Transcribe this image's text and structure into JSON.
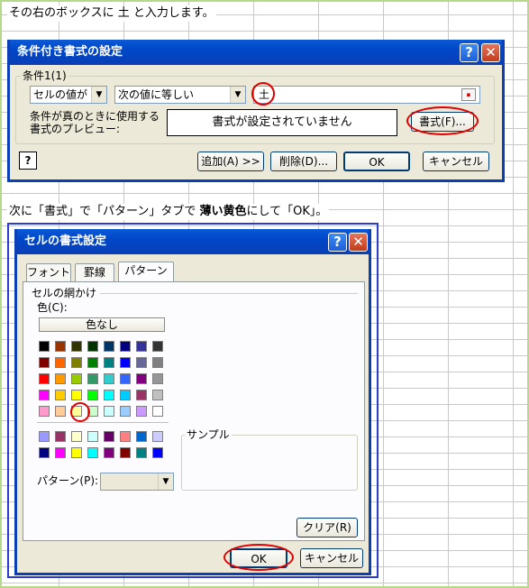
{
  "instructions": {
    "line1": "その右のボックスに 土 と入力します。",
    "line2_a": "次に「書式」で「パターン」タブで ",
    "line2_b": "薄い黄色",
    "line2_c": "にして「OK」。"
  },
  "conditional_format_dialog": {
    "title": "条件付き書式の設定",
    "condition_group": "条件1(1)",
    "combo1_value": "セルの値が",
    "combo2_value": "次の値に等しい",
    "input_value": "土",
    "preview_label": "条件が真のときに使用する書式のプレビュー:",
    "preview_text": "書式が設定されていません",
    "format_button": "書式(F)...",
    "add_button": "追加(A) >>",
    "delete_button": "削除(D)...",
    "ok_button": "OK",
    "cancel_button": "キャンセル",
    "help_icon": "?"
  },
  "cell_format_dialog": {
    "title": "セルの書式設定",
    "tabs": [
      "フォント",
      "罫線",
      "パターン"
    ],
    "active_tab": "パターン",
    "shading_group": "セルの網かけ",
    "color_label": "色(C):",
    "no_color_button": "色なし",
    "sample_group": "サンプル",
    "pattern_label": "パターン(P):",
    "clear_button": "クリア(R)",
    "ok_button": "OK",
    "cancel_button": "キャンセル",
    "palette_top": [
      [
        "#000000",
        "#993300",
        "#333300",
        "#003300",
        "#003366",
        "#000080",
        "#333399",
        "#333333"
      ],
      [
        "#800000",
        "#FF6600",
        "#808000",
        "#008000",
        "#008080",
        "#0000FF",
        "#666699",
        "#808080"
      ],
      [
        "#FF0000",
        "#FF9900",
        "#99CC00",
        "#339966",
        "#33CCCC",
        "#3366FF",
        "#800080",
        "#969696"
      ],
      [
        "#FF00FF",
        "#FFCC00",
        "#FFFF00",
        "#00FF00",
        "#00FFFF",
        "#00CCFF",
        "#993366",
        "#C0C0C0"
      ],
      [
        "#FF99CC",
        "#FFCC99",
        "#FFFF99",
        "#CCFFCC",
        "#CCFFFF",
        "#99CCFF",
        "#CC99FF",
        "#FFFFFF"
      ]
    ],
    "palette_bottom": [
      [
        "#9999FF",
        "#993366",
        "#FFFFCC",
        "#CCFFFF",
        "#660066",
        "#FF8080",
        "#0066CC",
        "#CCCCFF"
      ],
      [
        "#000080",
        "#FF00FF",
        "#FFFF00",
        "#00FFFF",
        "#800080",
        "#800000",
        "#008080",
        "#0000FF"
      ]
    ],
    "selected_color": "#FFFF99"
  },
  "colors": {
    "title_blue": "#0047c8",
    "highlight_red": "#e00000",
    "dialog_face": "#ece9d8"
  }
}
